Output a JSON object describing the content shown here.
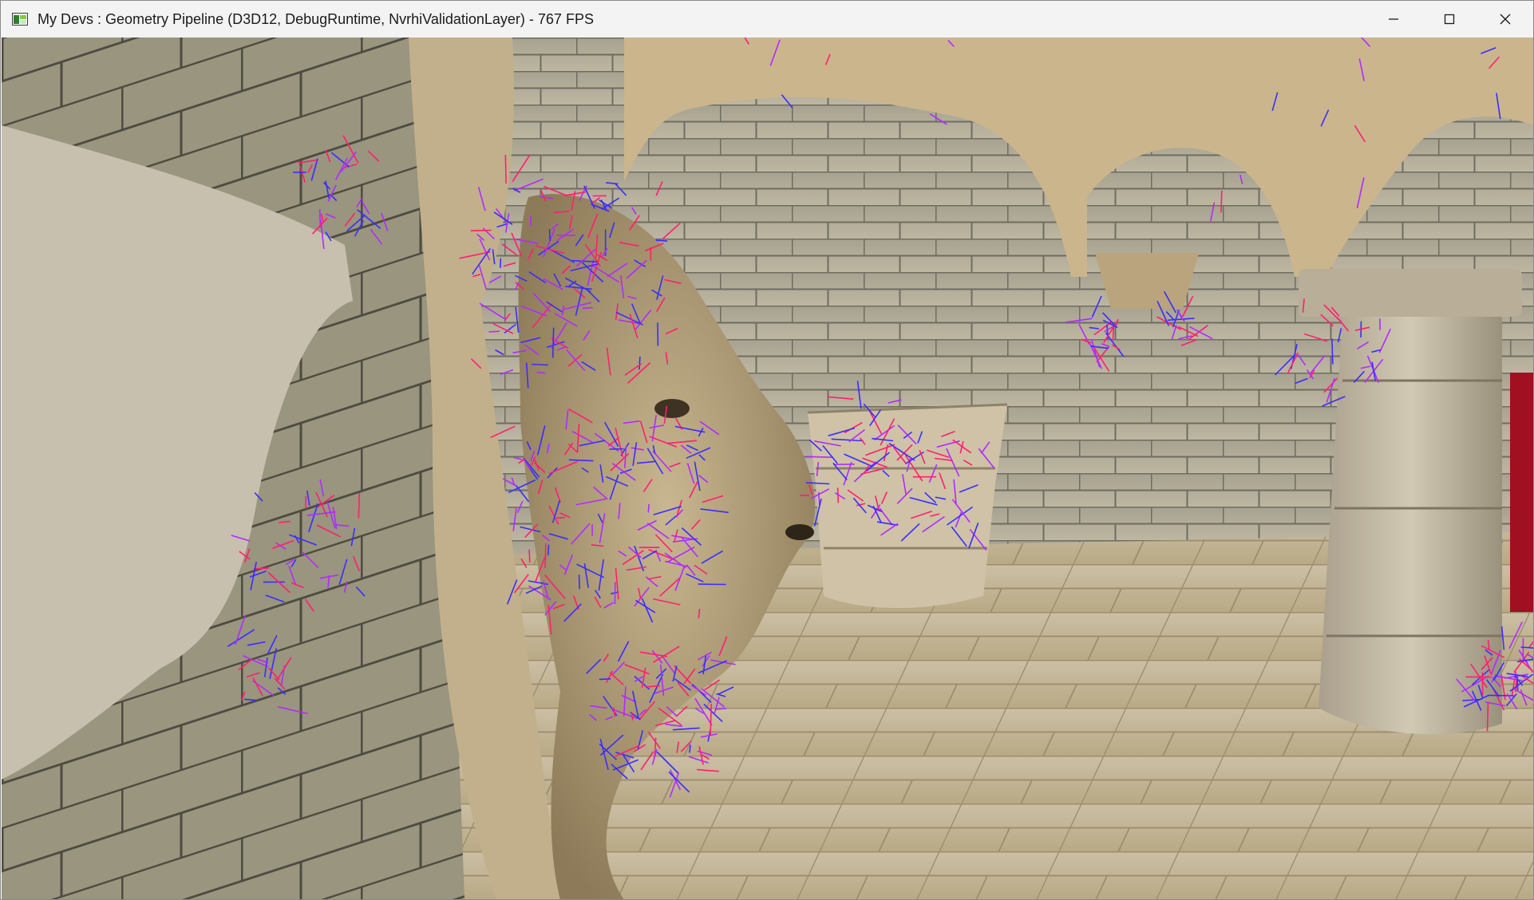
{
  "window": {
    "title": "My Devs : Geometry Pipeline (D3D12, DebugRuntime, NvrhiValidationLayer) - 767 FPS",
    "app_icon": "app-window-icon",
    "controls": {
      "minimize_icon": "minimize-icon",
      "maximize_icon": "maximize-icon",
      "close_icon": "close-icon"
    }
  },
  "viewport": {
    "scene": "3d-render-viewport",
    "normal_vector_colors": [
      "#ff1f6e",
      "#3b2cff",
      "#b02bff"
    ]
  }
}
